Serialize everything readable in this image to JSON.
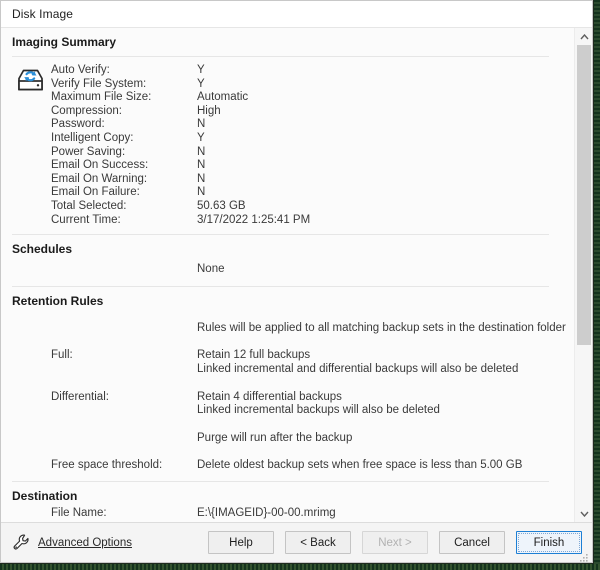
{
  "window": {
    "title": "Disk Image"
  },
  "sections": {
    "imaging_summary": {
      "heading": "Imaging Summary",
      "icon": "disk-image-icon",
      "rows": [
        {
          "label": "Auto Verify:",
          "value": "Y"
        },
        {
          "label": "Verify File System:",
          "value": "Y"
        },
        {
          "label": "Maximum File Size:",
          "value": "Automatic"
        },
        {
          "label": "Compression:",
          "value": "High"
        },
        {
          "label": "Password:",
          "value": "N"
        },
        {
          "label": "Intelligent Copy:",
          "value": "Y"
        },
        {
          "label": "Power Saving:",
          "value": "N"
        },
        {
          "label": "Email On Success:",
          "value": "N"
        },
        {
          "label": "Email On Warning:",
          "value": "N"
        },
        {
          "label": "Email On Failure:",
          "value": "N"
        },
        {
          "label": "Total Selected:",
          "value": "50.63 GB"
        },
        {
          "label": "Current Time:",
          "value": "3/17/2022 1:25:41 PM"
        }
      ]
    },
    "schedules": {
      "heading": "Schedules",
      "rows": [
        {
          "label": "",
          "value": "None"
        }
      ]
    },
    "retention_rules": {
      "heading": "Retention Rules",
      "intro": "Rules will be applied to all matching backup sets in the destination folder",
      "full": {
        "label": "Full:",
        "line1": "Retain 12 full backups",
        "line2": "Linked incremental and differential backups will also be deleted"
      },
      "differential": {
        "label": "Differential:",
        "line1": "Retain 4 differential backups",
        "line2": "Linked incremental backups will also be deleted"
      },
      "purge": "Purge will run after the backup",
      "free_space": {
        "label": "Free space threshold:",
        "value": "Delete oldest backup sets when free space is less than 5.00 GB"
      }
    },
    "destination": {
      "heading": "Destination",
      "rows": [
        {
          "label": "File Name:",
          "value": "E:\\{IMAGEID}-00-00.mrimg"
        }
      ]
    }
  },
  "scrollbar": {
    "up_arrow": "chevron-up-icon",
    "down_arrow": "chevron-down-icon"
  },
  "footer": {
    "advanced_options": {
      "icon": "wrench-icon",
      "label": "Advanced Options"
    },
    "buttons": [
      {
        "label": "Help",
        "state": "enabled"
      },
      {
        "label": "< Back",
        "state": "enabled"
      },
      {
        "label": "Next >",
        "state": "disabled"
      },
      {
        "label": "Cancel",
        "state": "enabled"
      },
      {
        "label": "Finish",
        "state": "default"
      }
    ]
  },
  "colors": {
    "accent": "#1d7fd4",
    "icon_blue": "#2b8fd8",
    "text": "#3a3a3a",
    "heading": "#1b1b1b"
  }
}
